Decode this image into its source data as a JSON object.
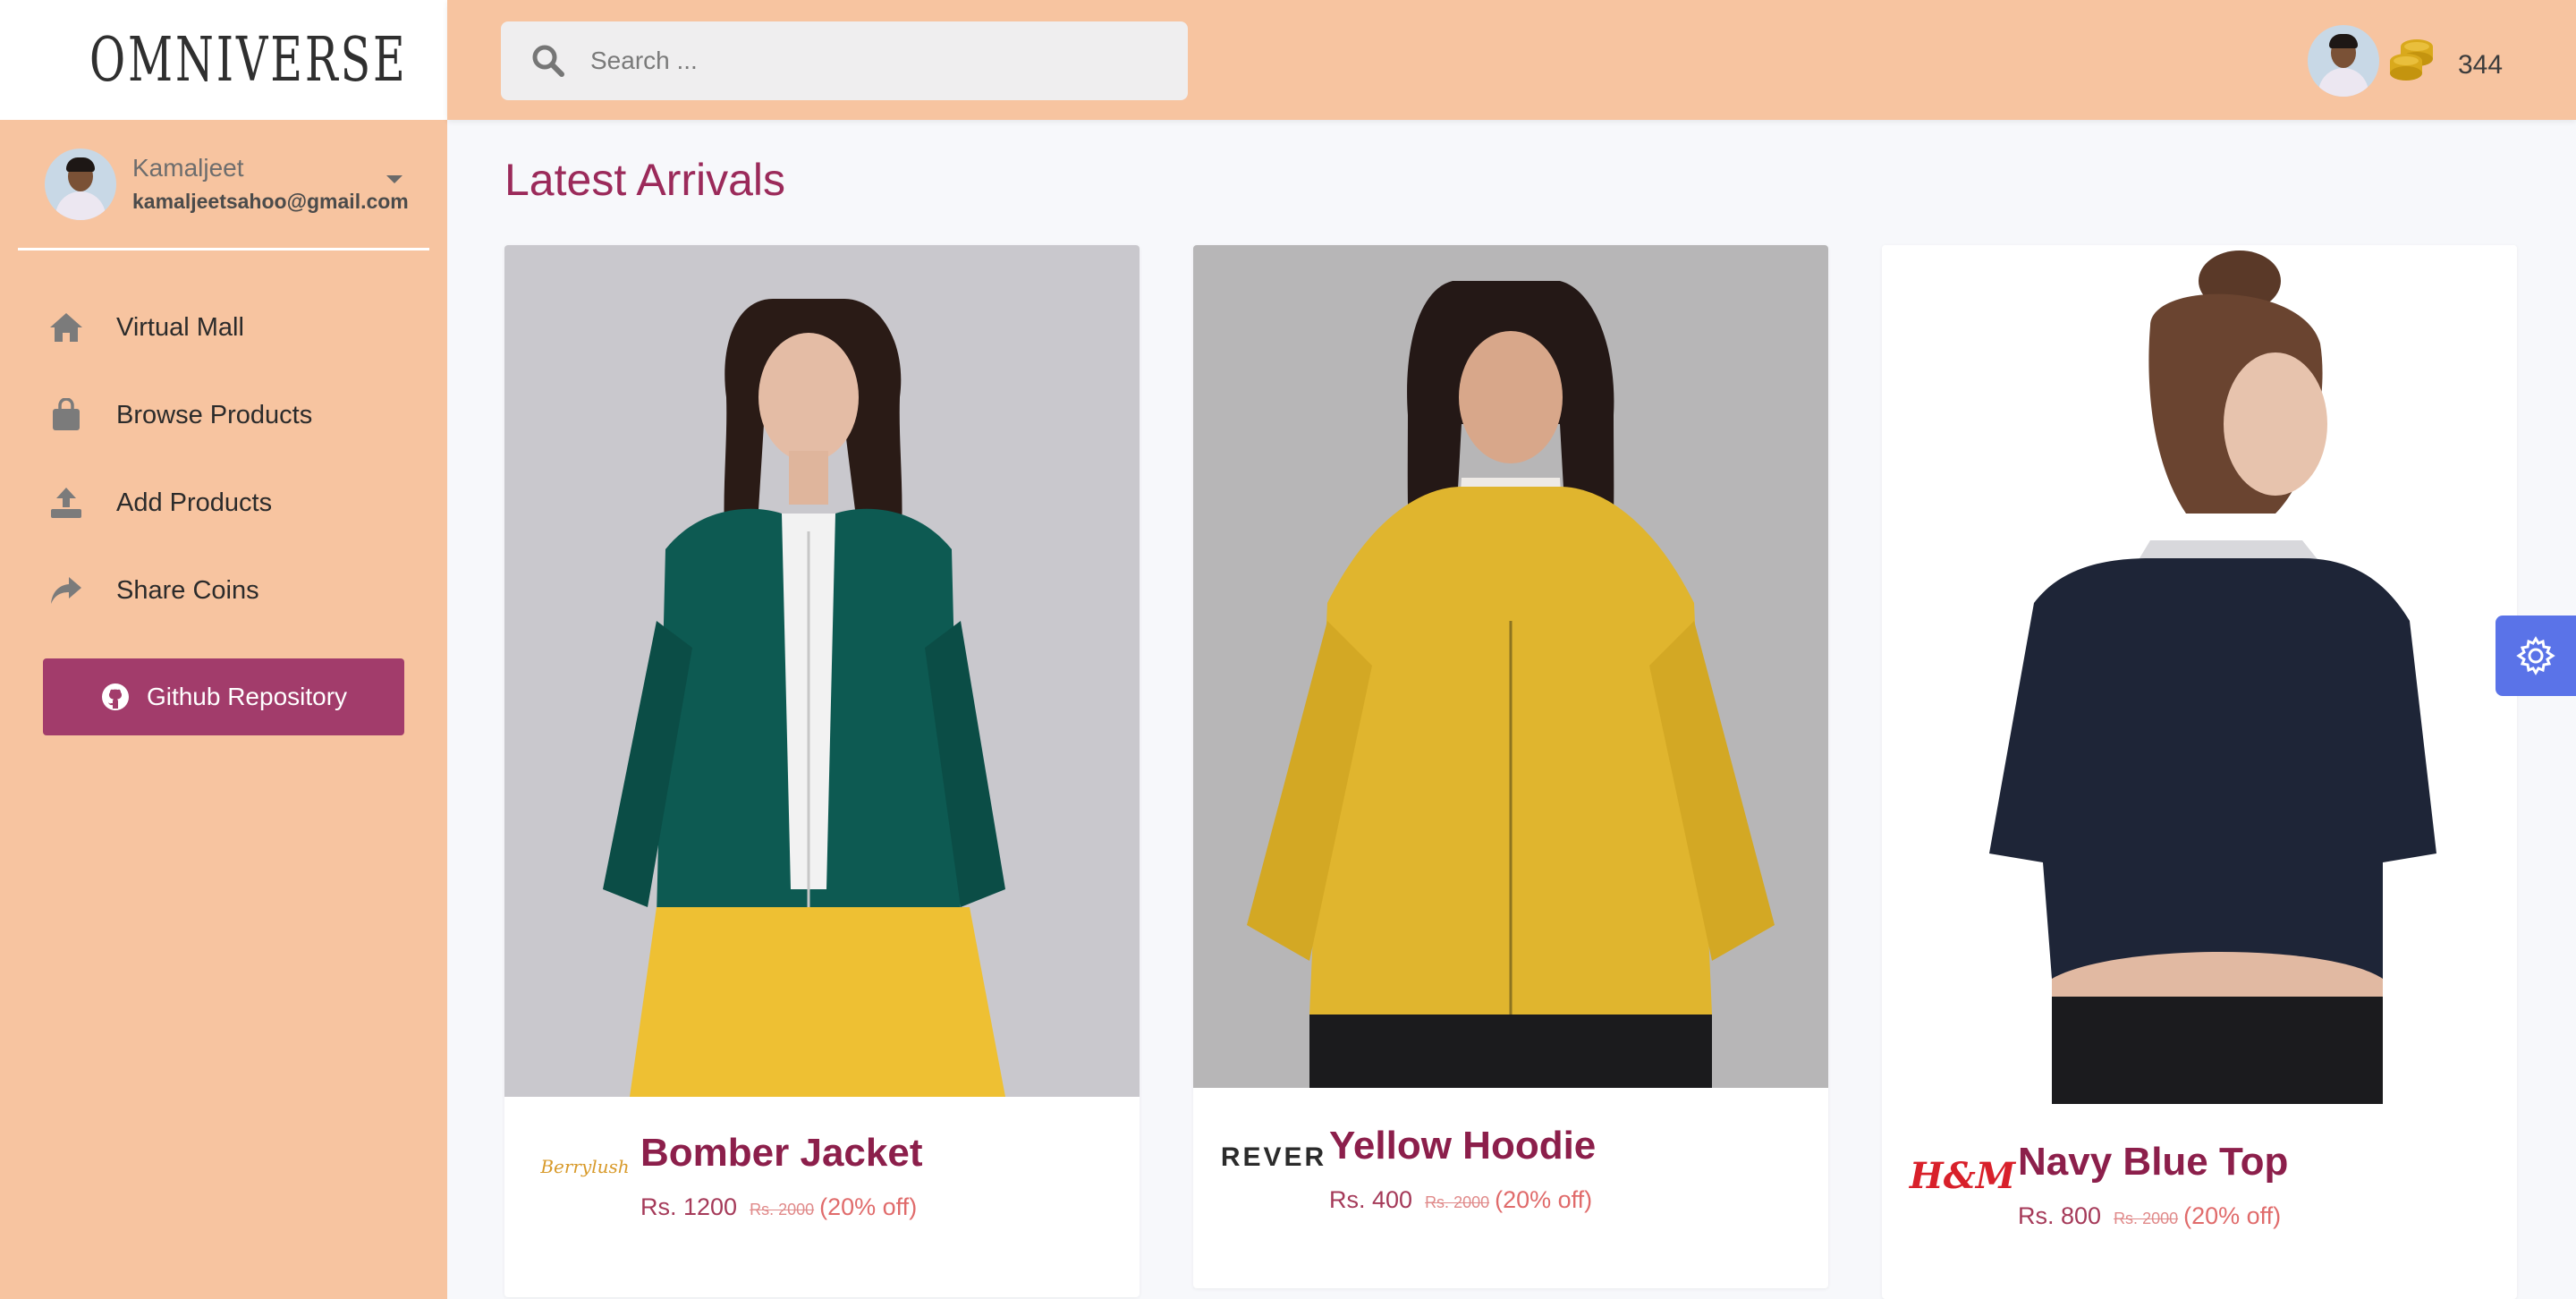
{
  "app": {
    "brand": "OMNIVERSE"
  },
  "user": {
    "name": "Kamaljeet",
    "email": "kamaljeetsahoo@gmail.com"
  },
  "sidebar": {
    "items": [
      {
        "label": "Virtual Mall",
        "icon": "home-icon"
      },
      {
        "label": "Browse Products",
        "icon": "shopping-bag-icon"
      },
      {
        "label": "Add Products",
        "icon": "upload-icon"
      },
      {
        "label": "Share Coins",
        "icon": "share-icon"
      }
    ],
    "github_label": "Github Repository"
  },
  "topbar": {
    "search_placeholder": "Search ...",
    "coin_count": "344"
  },
  "main": {
    "title": "Latest Arrivals",
    "products": [
      {
        "name": "Bomber Jacket",
        "price": "Rs. 1200",
        "old_price": "Rs. 2000",
        "discount": "(20% off)",
        "brand": "Berrylush"
      },
      {
        "name": "Yellow Hoodie",
        "price": "Rs. 400",
        "old_price": "Rs. 2000",
        "discount": "(20% off)",
        "brand": "REVER"
      },
      {
        "name": "Navy Blue Top",
        "price": "Rs. 800",
        "old_price": "Rs. 2000",
        "discount": "(20% off)",
        "brand": "H&M"
      }
    ]
  },
  "colors": {
    "accent": "#a23c6b",
    "sidebar_bg": "#f7c4a0",
    "title": "#9b2a5a",
    "settings": "#5a73e8"
  }
}
